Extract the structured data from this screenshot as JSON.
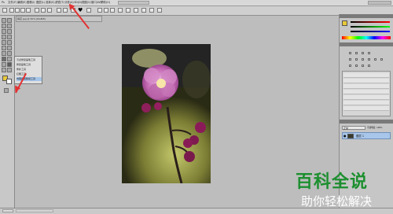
{
  "menubar": {
    "items": [
      "文件(F)",
      "编辑(E)",
      "图像(I)",
      "图层(L)",
      "选择(S)",
      "滤镜(T)",
      "分析(A)",
      "3D(D)",
      "视图(V)",
      "窗口(W)",
      "帮助(H)"
    ]
  },
  "doc_tab": "梅花.jpg @ 50% (RGB/8)",
  "flyout": {
    "items": [
      "污点修复画笔工具",
      "修复画笔工具",
      "修补工具",
      "红眼工具",
      "内容感知移动工具"
    ]
  },
  "layers": {
    "mode": "正常",
    "opacity": "不透明度: 100%",
    "layer_name": "图层 1"
  },
  "watermark": {
    "title": "百科全说",
    "subtitle": "助你轻松解决"
  },
  "colors": {
    "arrow": "#e33232",
    "watermark_green": "#1c8f2f"
  }
}
